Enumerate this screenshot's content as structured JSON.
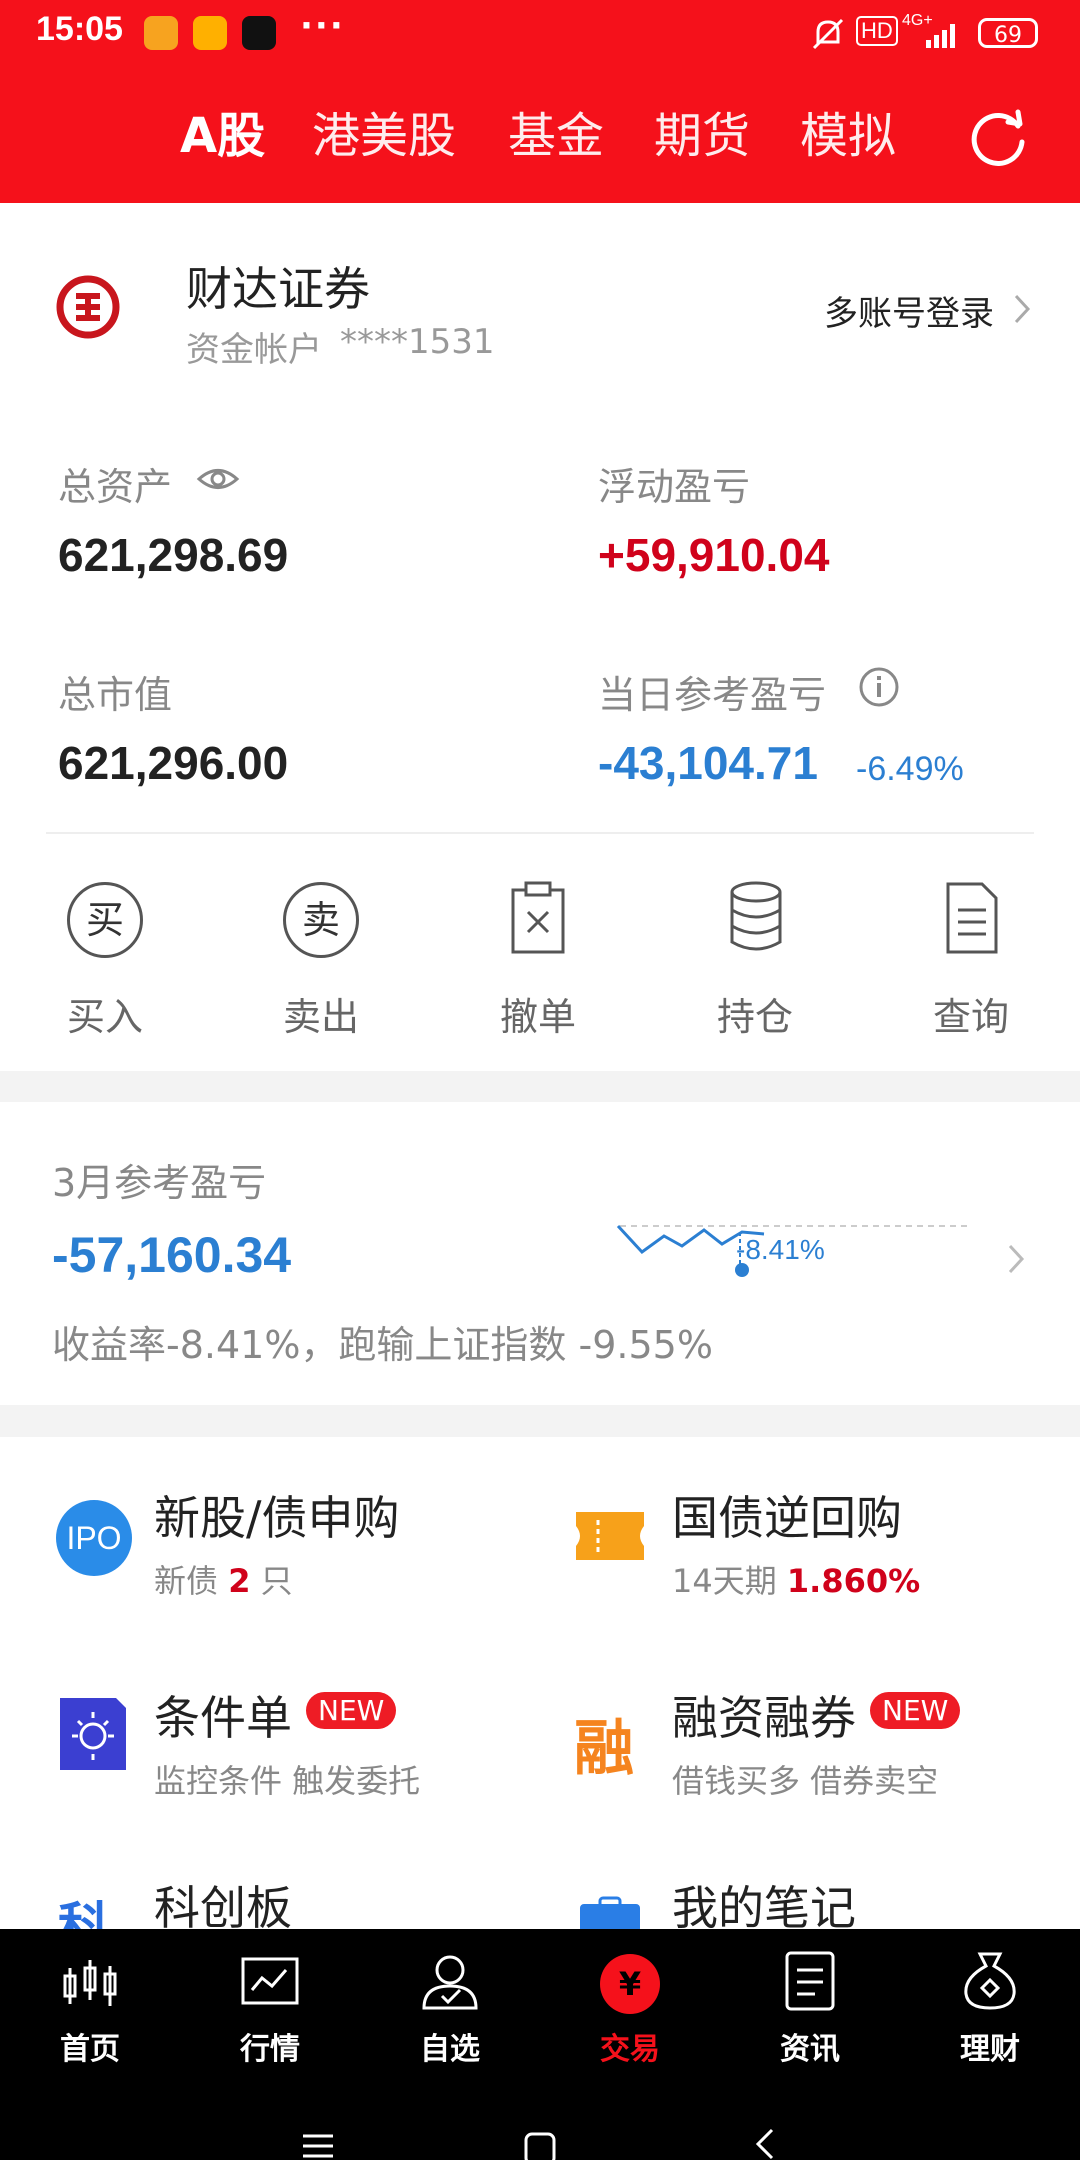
{
  "status_bar": {
    "time": "15:05",
    "dots": "···",
    "hd": "HD",
    "network": "4G+",
    "battery": "69"
  },
  "tabs": [
    "A股",
    "港美股",
    "基金",
    "期货",
    "模拟"
  ],
  "account": {
    "broker": "财达证券",
    "account_label": "资金帐户",
    "account_no": "****1531",
    "multi_login": "多账号登录"
  },
  "summary": {
    "total_assets_label": "总资产",
    "total_assets": "621,298.69",
    "floating_pl_label": "浮动盈亏",
    "floating_pl": "+59,910.04",
    "market_value_label": "总市值",
    "market_value": "621,296.00",
    "daily_pl_label": "当日参考盈亏",
    "daily_pl": "-43,104.71",
    "daily_pl_pct": "-6.49%"
  },
  "actions": [
    {
      "icon": "买",
      "label": "买入"
    },
    {
      "icon": "卖",
      "label": "卖出"
    },
    {
      "icon": "cancel-icon",
      "label": "撤单"
    },
    {
      "icon": "database-icon",
      "label": "持仓"
    },
    {
      "icon": "document-icon",
      "label": "查询"
    }
  ],
  "monthly": {
    "title": "3月参考盈亏",
    "value": "-57,160.34",
    "spark_label": "-8.41%",
    "desc": "收益率-8.41%，跑输上证指数 -9.55%"
  },
  "menu": [
    {
      "title": "新股/债申购",
      "sub_prefix": "新债 ",
      "sub_highlight": "2",
      "sub_suffix": " 只",
      "icon_text": "IPO"
    },
    {
      "title": "国债逆回购",
      "sub_prefix": "14天期 ",
      "sub_highlight": "1.860%",
      "sub_suffix": ""
    },
    {
      "title": "条件单",
      "badge": "NEW",
      "sub": "监控条件 触发委托"
    },
    {
      "title": "融资融券",
      "badge": "NEW",
      "sub": "借钱买多 借券卖空",
      "icon_text": "融"
    },
    {
      "title": "科创板",
      "icon_text": "科"
    },
    {
      "title": "我的笔记"
    }
  ],
  "bottom_nav": [
    {
      "label": "首页"
    },
    {
      "label": "行情"
    },
    {
      "label": "自选"
    },
    {
      "label": "交易",
      "icon_text": "¥"
    },
    {
      "label": "资讯"
    },
    {
      "label": "理财"
    }
  ],
  "colors": {
    "brand_red": "#f5111b",
    "loss_blue": "#2b7fd2",
    "gain_red": "#d0021b"
  }
}
